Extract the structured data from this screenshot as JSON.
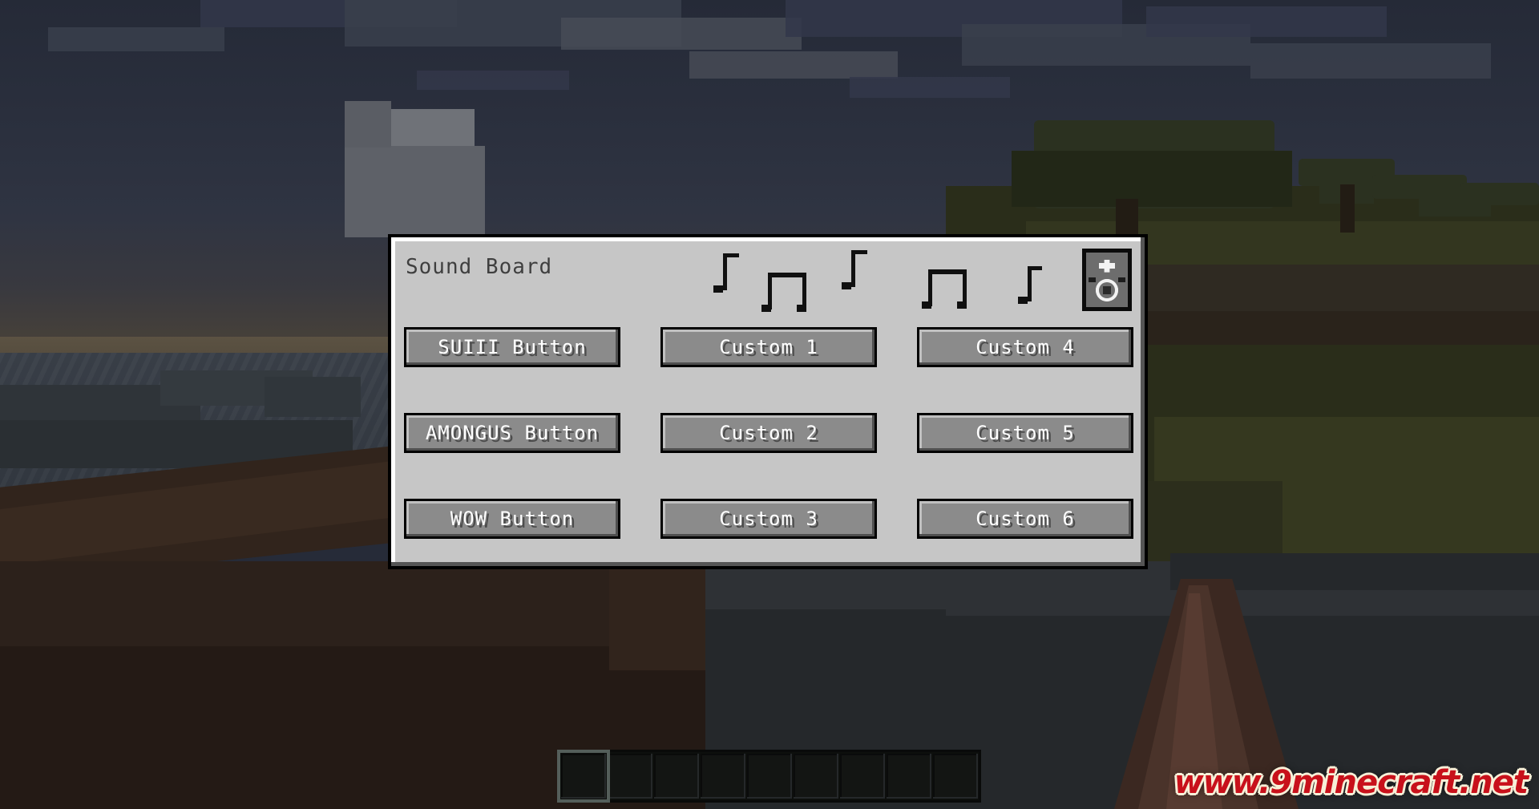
{
  "window": {
    "title": "Sound Board"
  },
  "header": {
    "title": "Sound Board",
    "speaker_icon": "speaker-icon",
    "notes": [
      {
        "icon": "eighth-note-icon"
      },
      {
        "icon": "beamed-eighth-notes-icon"
      },
      {
        "icon": "eighth-note-icon"
      },
      {
        "icon": "beamed-eighth-notes-icon"
      },
      {
        "icon": "eighth-note-icon"
      }
    ]
  },
  "buttons": {
    "columns": [
      {
        "name": "preset-sounds",
        "items": [
          {
            "label": "SUIII Button"
          },
          {
            "label": "AMONGUS Button"
          },
          {
            "label": "WOW Button"
          }
        ]
      },
      {
        "name": "custom-sounds-a",
        "items": [
          {
            "label": "Custom 1"
          },
          {
            "label": "Custom 2"
          },
          {
            "label": "Custom 3"
          }
        ]
      },
      {
        "name": "custom-sounds-b",
        "items": [
          {
            "label": "Custom 4"
          },
          {
            "label": "Custom 5"
          },
          {
            "label": "Custom 6"
          }
        ]
      }
    ],
    "flat": [
      "SUIII Button",
      "Custom 1",
      "Custom 4",
      "AMONGUS Button",
      "Custom 2",
      "Custom 5",
      "WOW Button",
      "Custom 3",
      "Custom 6"
    ]
  },
  "hotbar": {
    "slot_count": 9,
    "selected_index": 0,
    "slots": [
      "",
      "",
      "",
      "",
      "",
      "",
      "",
      "",
      ""
    ]
  },
  "watermark": {
    "text": "www.9minecraft.net"
  },
  "colors": {
    "panel_background": "#c6c6c6",
    "panel_border": "#000000",
    "panel_highlight": "#ffffff",
    "panel_shadow": "#555555",
    "button_face": "#8b8b8b",
    "button_text": "#ffffff",
    "title_text": "#3f3f3f",
    "note_color": "#101010",
    "watermark_red": "#c8111b",
    "watermark_outline": "#f7f0d8",
    "sky": "#2a2f3d"
  },
  "scene": {
    "biome": "savanna",
    "time_of_day": "dusk"
  }
}
